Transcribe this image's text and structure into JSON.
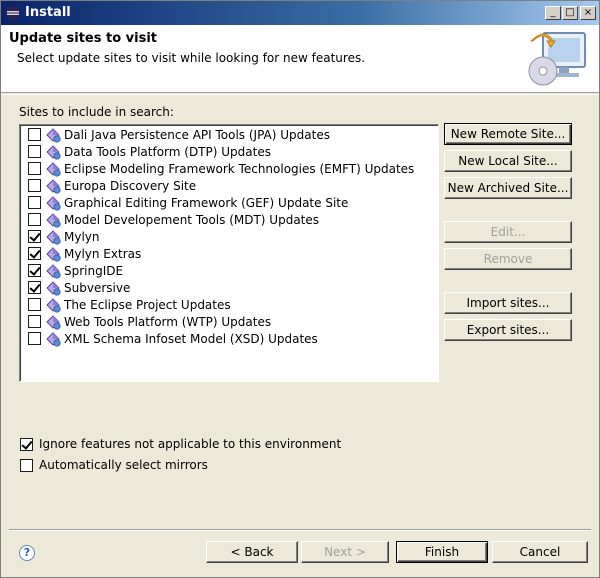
{
  "window": {
    "title": "Install"
  },
  "header": {
    "title": "Update sites to visit",
    "subtitle": "Select update sites to visit while looking for new features."
  },
  "sites_label": "Sites to include in search:",
  "sites": [
    {
      "label": "Dali Java Persistence API Tools (JPA) Updates",
      "checked": false
    },
    {
      "label": "Data Tools Platform (DTP) Updates",
      "checked": false
    },
    {
      "label": "Eclipse Modeling Framework Technologies (EMFT) Updates",
      "checked": false
    },
    {
      "label": "Europa Discovery Site",
      "checked": false
    },
    {
      "label": "Graphical Editing Framework (GEF) Update Site",
      "checked": false
    },
    {
      "label": "Model Developement Tools (MDT) Updates",
      "checked": false
    },
    {
      "label": "Mylyn",
      "checked": true
    },
    {
      "label": "Mylyn Extras",
      "checked": true
    },
    {
      "label": "SpringIDE",
      "checked": true
    },
    {
      "label": "Subversive",
      "checked": true
    },
    {
      "label": "The Eclipse Project Updates",
      "checked": false
    },
    {
      "label": "Web Tools Platform (WTP) Updates",
      "checked": false
    },
    {
      "label": "XML Schema Infoset Model (XSD) Updates",
      "checked": false
    }
  ],
  "side_buttons": {
    "new_remote": "New Remote Site...",
    "new_local": "New Local Site...",
    "new_archived": "New Archived Site...",
    "edit": "Edit...",
    "remove": "Remove",
    "import": "Import sites...",
    "export": "Export sites..."
  },
  "options": {
    "ignore_features": {
      "label": "Ignore features not applicable to this environment",
      "checked": true
    },
    "auto_mirrors": {
      "label": "Automatically select mirrors",
      "checked": false
    }
  },
  "footer": {
    "back": "< Back",
    "next": "Next >",
    "finish": "Finish",
    "cancel": "Cancel",
    "help_icon": "?"
  },
  "icons": {
    "app": "eclipse-icon",
    "banner": "install-banner-icon",
    "site": "update-site-icon"
  }
}
